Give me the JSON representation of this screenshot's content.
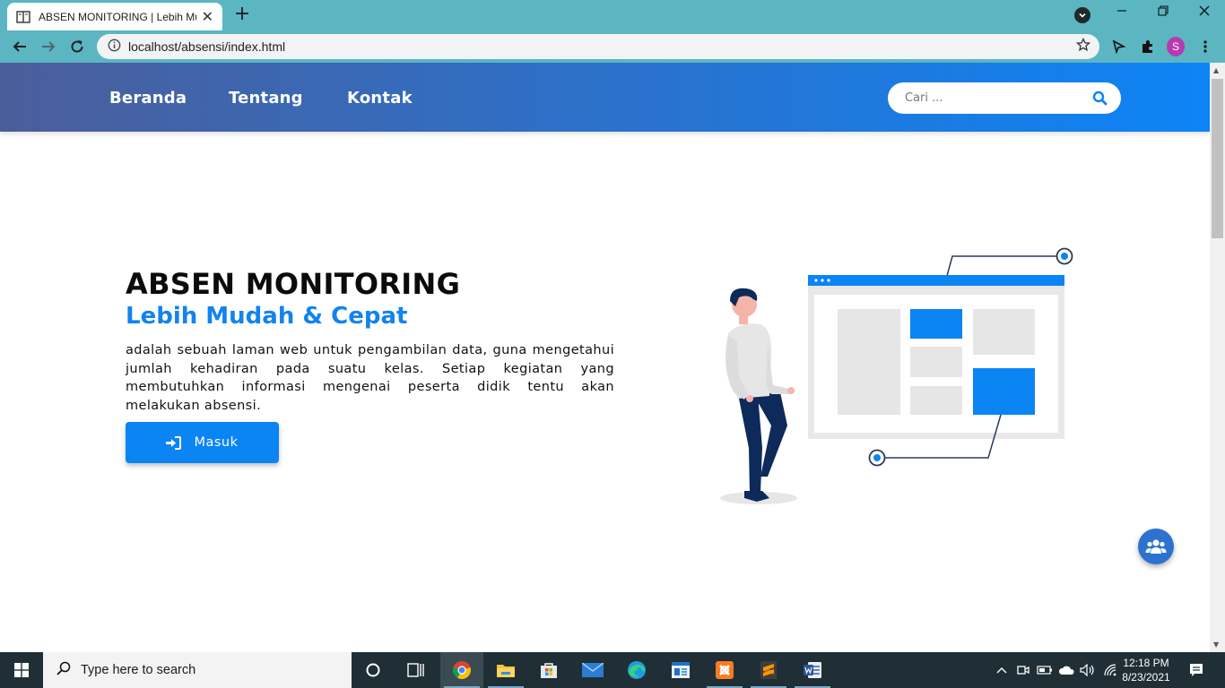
{
  "browser": {
    "tab_title": "ABSEN MONITORING | Lebih Mudah & Cepat",
    "tab_close": "✕",
    "new_tab": "+",
    "url": "localhost/absensi/index.html",
    "profile_initial": "S"
  },
  "nav": {
    "links": [
      "Beranda",
      "Tentang",
      "Kontak"
    ],
    "search_placeholder": "Cari ..."
  },
  "hero": {
    "title": "ABSEN MONITORING",
    "subtitle": "Lebih Mudah & Cepat",
    "description": "adalah sebuah laman web untuk pengambilan data, guna mengetahui jumlah kehadiran pada suatu kelas. Setiap kegiatan yang membutuhkan informasi mengenai peserta didik tentu akan melakukan absensi.",
    "button_label": "Masuk"
  },
  "colors": {
    "accent": "#0b84f4",
    "navbar_start": "#4b5e9a",
    "navbar_end": "#0d84f6",
    "browser_frame": "#5bb6c2"
  },
  "taskbar": {
    "search_placeholder": "Type here to search",
    "time": "12:18 PM",
    "date": "8/23/2021"
  }
}
